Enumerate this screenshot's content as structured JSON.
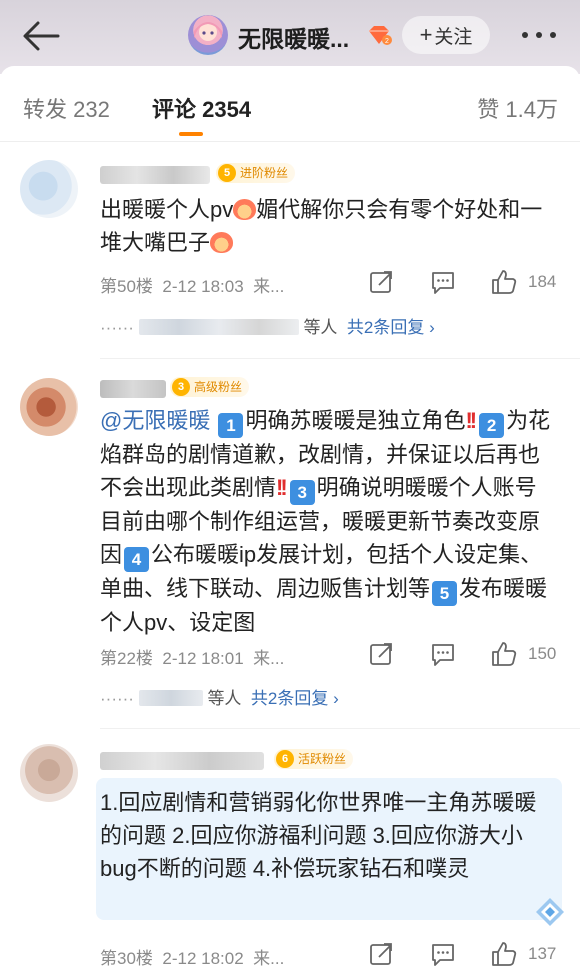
{
  "header": {
    "title": "无限暖暖...",
    "follow_label": "关注",
    "more_label": "•••"
  },
  "tabs": [
    {
      "label": "转发 232"
    },
    {
      "label": "评论 2354"
    },
    {
      "label": "赞 1.4万"
    }
  ],
  "colors": {
    "accent": "#ff8200",
    "link": "#3a6fb5",
    "number_box": "#3d8fe0",
    "badge_text": "#e08a00"
  },
  "comments": [
    {
      "badge_level": "5",
      "badge_label": "进阶粉丝",
      "text_a": "出暖暖个人pv",
      "text_b": "媚代解你只会有零个好处和一堆大嘴巴子",
      "floor": "第50楼",
      "time": "2-12 18:03",
      "location": "来...",
      "likes": "184",
      "reply_suffix": "等人",
      "reply_link": "共2条回复 ›"
    },
    {
      "badge_level": "3",
      "badge_label": "高级粉丝",
      "mention": "@无限暖暖",
      "n1": "1",
      "t1": "明确苏暖暖是独立角色",
      "n2": "2",
      "t2": "为花焰群岛的剧情道歉，改剧情，并保证以后再也不会出现此类剧情",
      "n3": "3",
      "t3": "明确说明暖暖个人账号目前由哪个制作组运营，暖暖更新节奏改变原因",
      "n4": "4",
      "t4": "公布暖暖ip发展计划，包括个人设定集、单曲、线下联动、周边贩售计划等",
      "n5": "5",
      "t5": "发布暖暖个人pv、设定图",
      "floor": "第22楼",
      "time": "2-12 18:01",
      "location": "来...",
      "likes": "150",
      "reply_suffix": "等人",
      "reply_link": "共2条回复 ›"
    },
    {
      "badge_level": "6",
      "badge_label": "活跃粉丝",
      "text": "1.回应剧情和营销弱化你世界唯一主角苏暖暖的问题 2.回应你游福利问题 3.回应你游大小bug不断的问题 4.补偿玩家钻石和噗灵",
      "floor": "第30楼",
      "time": "2-12 18:02",
      "location": "来...",
      "likes": "137"
    }
  ]
}
